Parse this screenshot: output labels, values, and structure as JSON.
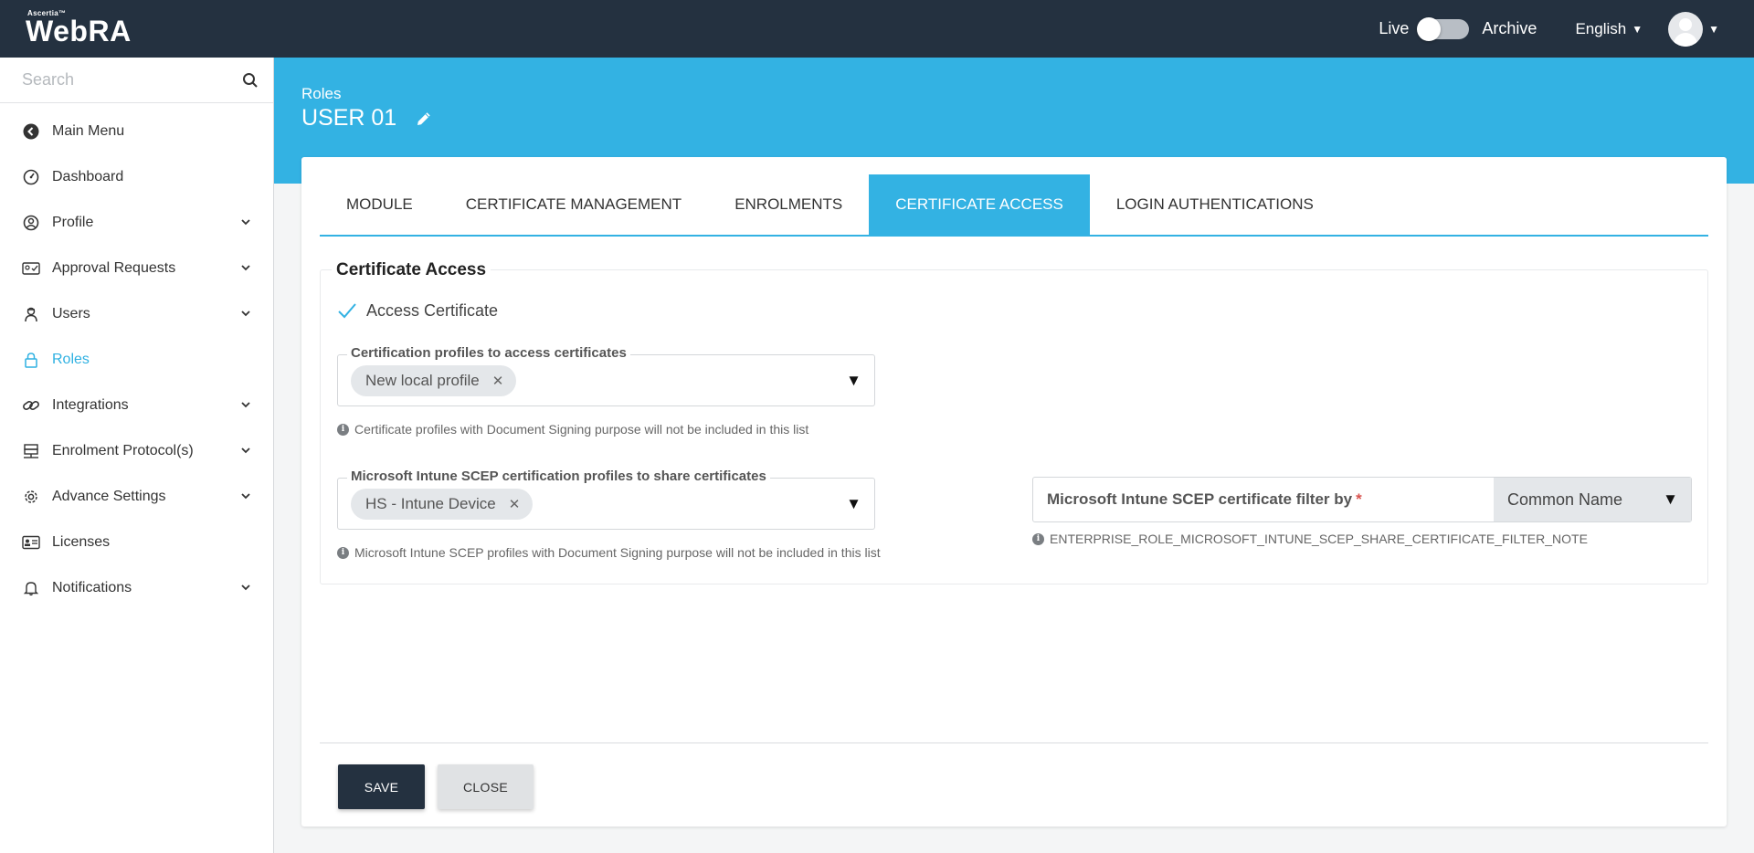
{
  "header": {
    "brand_small": "Ascertia™",
    "brand": "WebRA",
    "live_label": "Live",
    "archive_label": "Archive",
    "language": "English"
  },
  "sidebar": {
    "search_placeholder": "Search",
    "items": [
      {
        "label": "Main Menu",
        "icon": "back-circle-icon",
        "expandable": false
      },
      {
        "label": "Dashboard",
        "icon": "dashboard-gauge-icon",
        "expandable": false
      },
      {
        "label": "Profile",
        "icon": "user-circle-icon",
        "expandable": true
      },
      {
        "label": "Approval Requests",
        "icon": "id-card-check-icon",
        "expandable": true
      },
      {
        "label": "Users",
        "icon": "user-agent-icon",
        "expandable": true
      },
      {
        "label": "Roles",
        "icon": "lock-icon",
        "expandable": false,
        "active": true
      },
      {
        "label": "Integrations",
        "icon": "link-icon",
        "expandable": true
      },
      {
        "label": "Enrolment Protocol(s)",
        "icon": "server-rack-icon",
        "expandable": true
      },
      {
        "label": "Advance Settings",
        "icon": "gear-icon",
        "expandable": true
      },
      {
        "label": "Licenses",
        "icon": "id-card-icon",
        "expandable": false
      },
      {
        "label": "Notifications",
        "icon": "bell-icon",
        "expandable": true
      }
    ]
  },
  "page": {
    "breadcrumb": "Roles",
    "title": "USER 01"
  },
  "tabs": [
    {
      "label": "MODULE",
      "active": false
    },
    {
      "label": "CERTIFICATE MANAGEMENT",
      "active": false
    },
    {
      "label": "ENROLMENTS",
      "active": false
    },
    {
      "label": "CERTIFICATE ACCESS",
      "active": true
    },
    {
      "label": "LOGIN AUTHENTICATIONS",
      "active": false
    }
  ],
  "certificate_access": {
    "section_title": "Certificate Access",
    "access_certificate_label": "Access Certificate",
    "access_certificate_checked": true,
    "profiles_legend": "Certification profiles to access certificates",
    "profiles_chip": "New local profile",
    "profiles_note": "Certificate profiles with Document Signing purpose will not be included in this list",
    "intune_legend": "Microsoft Intune SCEP certification profiles to share certificates",
    "intune_chip": "HS - Intune Device",
    "intune_note": "Microsoft Intune SCEP profiles with Document Signing purpose will not be included in this list",
    "filter_label": "Microsoft Intune SCEP certificate filter by",
    "filter_required_mark": "*",
    "filter_value": "Common Name",
    "filter_note": "ENTERPRISE_ROLE_MICROSOFT_INTUNE_SCEP_SHARE_CERTIFICATE_FILTER_NOTE"
  },
  "actions": {
    "save_label": "SAVE",
    "close_label": "CLOSE"
  },
  "colors": {
    "topbar": "#243140",
    "accent": "#33b2e3",
    "active_menu": "#2fb1e2"
  }
}
